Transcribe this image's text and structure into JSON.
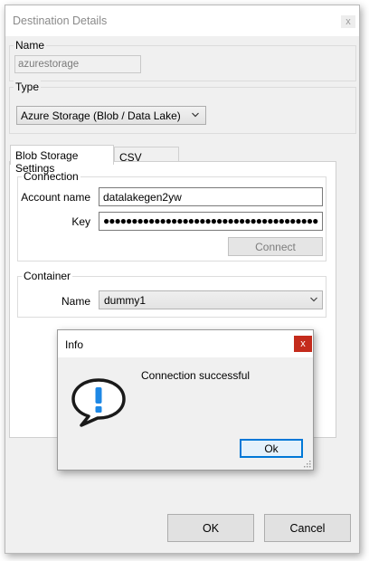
{
  "window": {
    "title": "Destination Details",
    "close_glyph": "x"
  },
  "name_group": {
    "label": "Name",
    "value": "azurestorage"
  },
  "type_group": {
    "label": "Type",
    "selected": "Azure Storage (Blob / Data Lake)"
  },
  "tabs": [
    {
      "label": "Blob Storage Settings",
      "active": true
    },
    {
      "label": "CSV Settings",
      "active": false
    }
  ],
  "connection": {
    "label": "Connection",
    "account_name_label": "Account name",
    "account_name_value": "datalakegen2yw",
    "key_label": "Key",
    "key_value": "●●●●●●●●●●●●●●●●●●●●●●●●●●●●●●●●●●●●●●",
    "connect_label": "Connect"
  },
  "container": {
    "label": "Container",
    "name_label": "Name",
    "name_value": "dummy1"
  },
  "footer": {
    "ok_label": "OK",
    "cancel_label": "Cancel"
  },
  "info_dialog": {
    "title": "Info",
    "close_glyph": "x",
    "message": "Connection successful",
    "ok_label": "Ok",
    "icon": "exclamation-speech-bubble-icon"
  },
  "colors": {
    "dialog_close_red": "#c42b1c",
    "ok_accent": "#0078d7",
    "icon_blue": "#1e88e5"
  }
}
